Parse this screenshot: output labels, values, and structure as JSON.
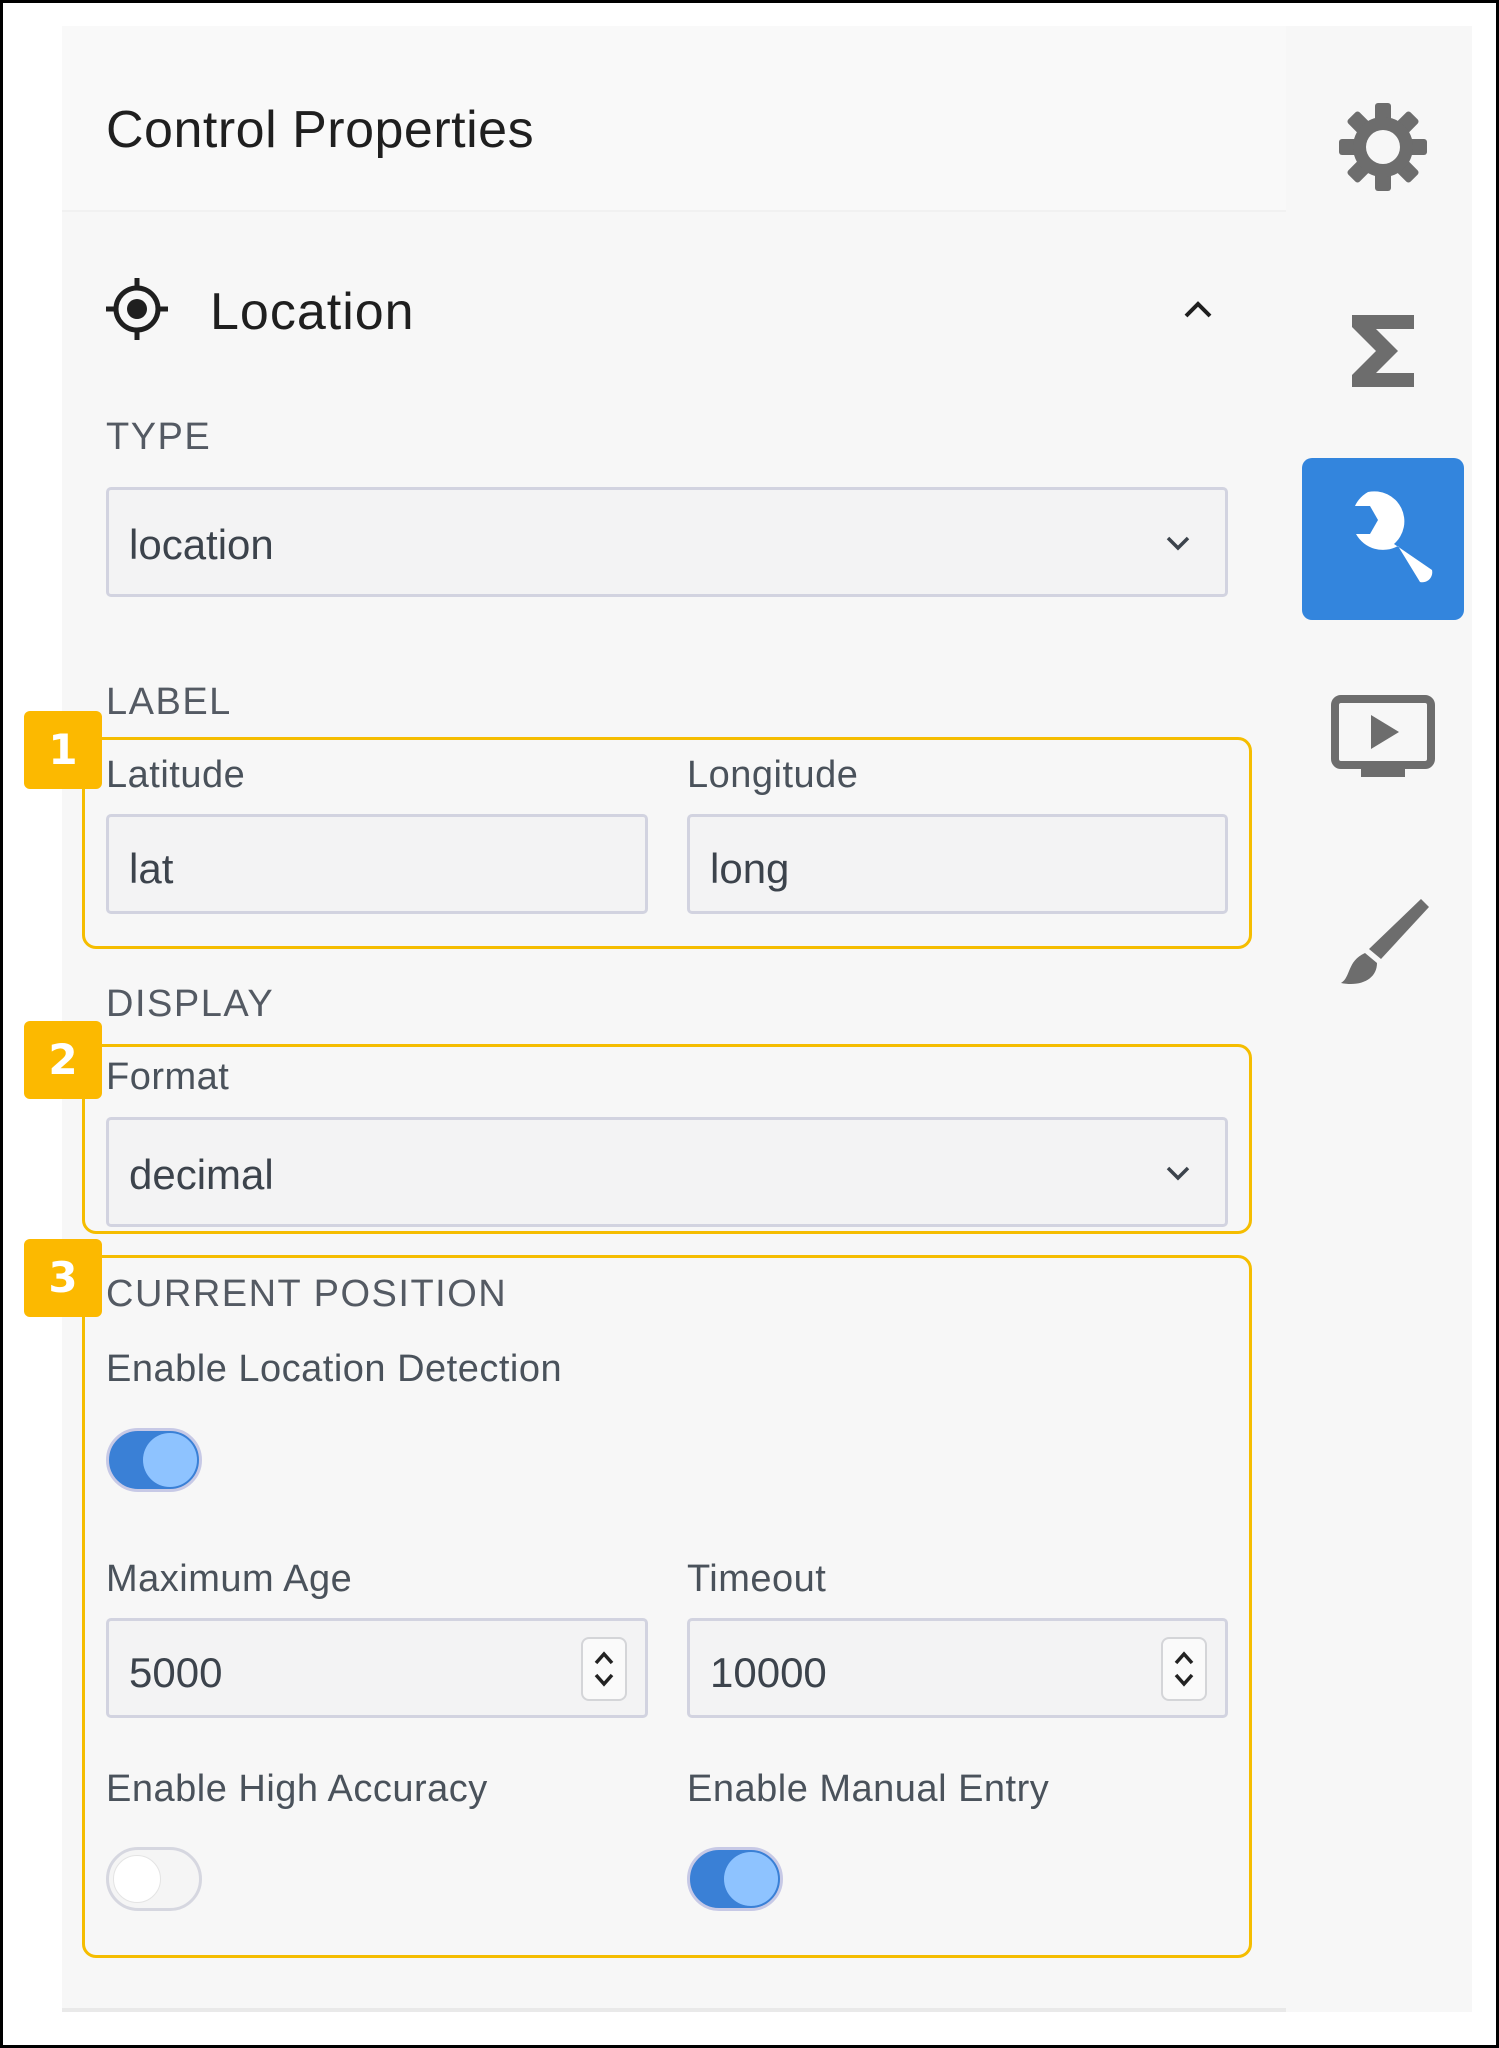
{
  "panel": {
    "title": "Control Properties"
  },
  "rail": {
    "items": [
      {
        "icon": "gear-icon",
        "active": false
      },
      {
        "icon": "sigma-icon",
        "active": false
      },
      {
        "icon": "wrench-icon",
        "active": true
      },
      {
        "icon": "preview-icon",
        "active": false
      },
      {
        "icon": "brush-icon",
        "active": false
      }
    ],
    "accent": "#3385dd"
  },
  "section": {
    "title": "Location",
    "icon": "crosshair-icon",
    "collapse_icon": "chevron-up-icon"
  },
  "type_group": {
    "title": "TYPE",
    "value": "location"
  },
  "label_group": {
    "title": "LABEL",
    "latitude": {
      "label": "Latitude",
      "value": "lat"
    },
    "longitude": {
      "label": "Longitude",
      "value": "long"
    }
  },
  "display_group": {
    "title": "DISPLAY",
    "format": {
      "label": "Format",
      "value": "decimal"
    }
  },
  "position_group": {
    "title": "CURRENT POSITION",
    "detection": {
      "label": "Enable Location Detection",
      "on": true
    },
    "max_age": {
      "label": "Maximum Age",
      "value": "5000"
    },
    "timeout": {
      "label": "Timeout",
      "value": "10000"
    },
    "high_accuracy": {
      "label": "Enable High Accuracy",
      "on": false
    },
    "manual_entry": {
      "label": "Enable Manual Entry",
      "on": true
    }
  },
  "callouts": [
    "1",
    "2",
    "3"
  ],
  "colors": {
    "callout": "#f5bd00",
    "badge": "#fcb900",
    "toggle_on": "#3a80d6",
    "knob_on": "#8ec3ff"
  }
}
